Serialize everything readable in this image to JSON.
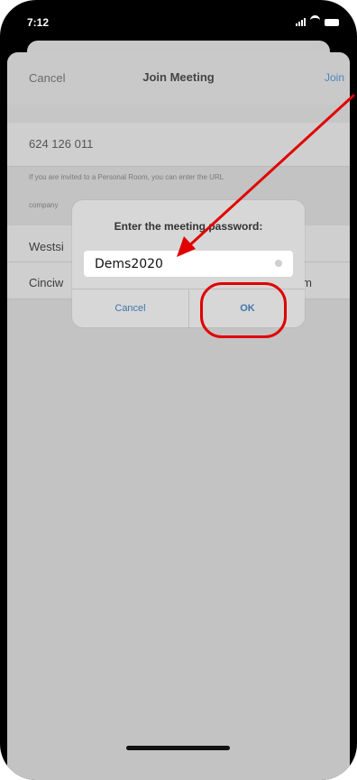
{
  "status_bar": {
    "time": "7:12"
  },
  "nav": {
    "cancel": "Cancel",
    "title": "Join Meeting",
    "join": "Join"
  },
  "form": {
    "meeting_id": "624 126 011",
    "hint": "If you are invited to a Personal Room, you can enter the URL",
    "company_prefix": "company",
    "name_prefix": "Westsi",
    "second_prefix": "Cinciw",
    "second_suffix": "m"
  },
  "dialog": {
    "title": "Enter the meeting password:",
    "password_value": "Dems2020",
    "cancel": "Cancel",
    "ok": "OK"
  },
  "colors": {
    "annotation": "#e00000",
    "link": "#4b86bf"
  }
}
